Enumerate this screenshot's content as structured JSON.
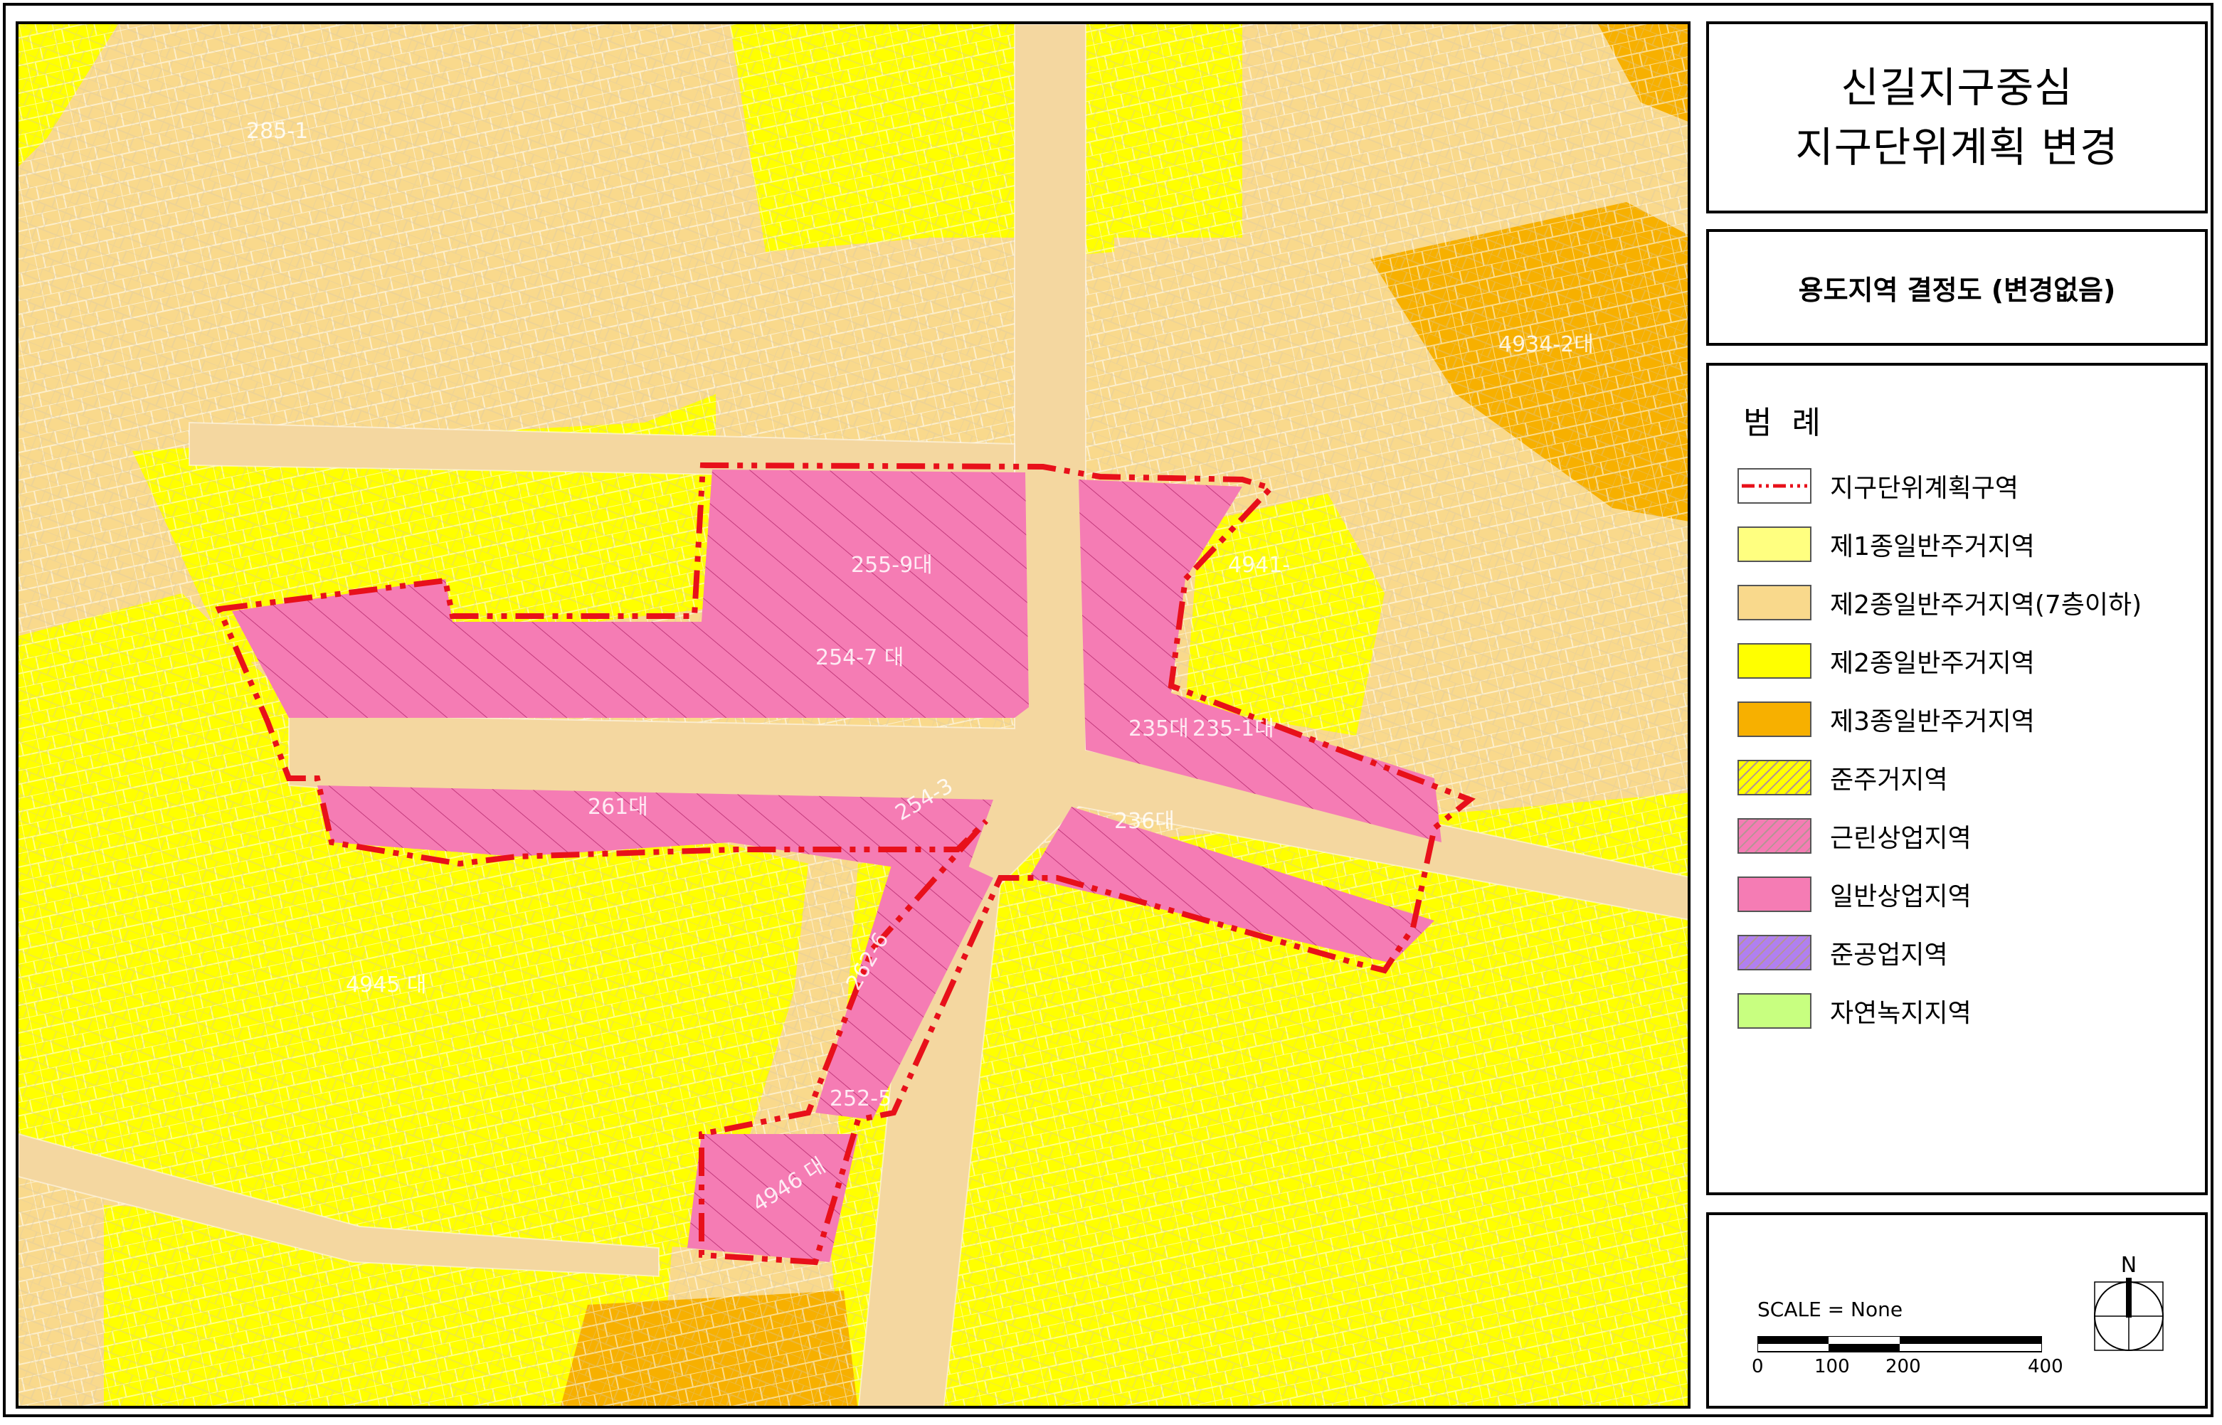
{
  "title": {
    "line1": "신길지구중심",
    "line2": "지구단위계획 변경"
  },
  "subtitle": "용도지역 결정도 (변경없음)",
  "legend": {
    "heading": "범례",
    "items": [
      {
        "label": "지구단위계획구역",
        "kind": "boundary",
        "color": "#e8101a"
      },
      {
        "label": "제1종일반주거지역",
        "kind": "fill",
        "color": "#ffff80"
      },
      {
        "label": "제2종일반주거지역(7층이하)",
        "kind": "fill",
        "color": "#f9d98c"
      },
      {
        "label": "제2종일반주거지역",
        "kind": "fill",
        "color": "#ffff00"
      },
      {
        "label": "제3종일반주거지역",
        "kind": "fill",
        "color": "#f7b000"
      },
      {
        "label": "준주거지역",
        "kind": "hatch",
        "color": "#ffff00"
      },
      {
        "label": "근린상업지역",
        "kind": "hatch",
        "color": "#f57cb4"
      },
      {
        "label": "일반상업지역",
        "kind": "fill",
        "color": "#f57cb4"
      },
      {
        "label": "준공업지역",
        "kind": "hatch",
        "color": "#b080f0"
      },
      {
        "label": "자연녹지지역",
        "kind": "fill",
        "color": "#c8ff80"
      }
    ]
  },
  "scale": {
    "label": "SCALE = None",
    "ticks": [
      "0",
      "100",
      "200",
      "400"
    ]
  },
  "north_label": "N",
  "map_labels": [
    "285-1",
    "255-9대",
    "254-7 대",
    "261대",
    "254-3",
    "235-1대",
    "235대",
    "236대",
    "262-6",
    "252-5",
    "4946 대",
    "4945 대",
    "4934-2대",
    "4941-"
  ],
  "colors": {
    "zone2_7": "#f9d98c",
    "zone2": "#ffff00",
    "zone3": "#f7b000",
    "commercial": "#f57cb4",
    "road": "#f4d7a0",
    "boundary": "#e8101a"
  }
}
